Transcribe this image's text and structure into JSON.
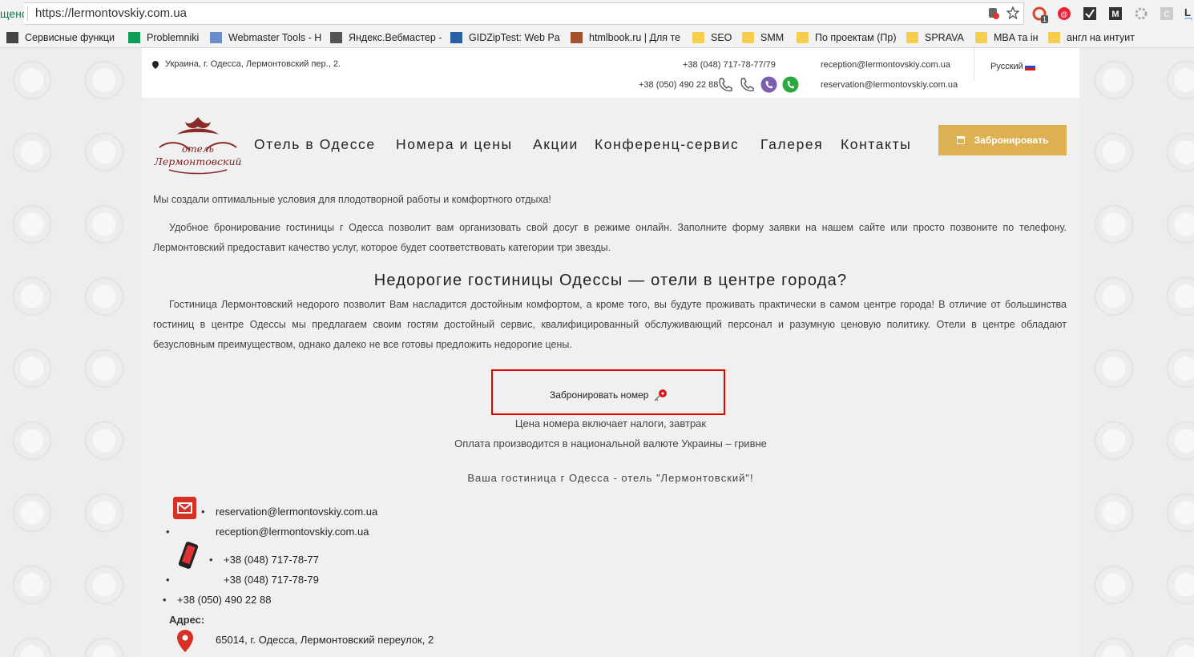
{
  "browser": {
    "secure_prefix": "щено",
    "url": "https://lermontovskiy.com.ua",
    "bookmarks": [
      {
        "label": "Сервисные функци",
        "icon": "printer-icon"
      },
      {
        "label": "Problemniki",
        "icon": "sheets-icon"
      },
      {
        "label": "Webmaster Tools - Н",
        "icon": "webmaster-icon"
      },
      {
        "label": "Яндекс.Вебмастер -",
        "icon": "code-icon"
      },
      {
        "label": "GIDZipTest: Web Pa",
        "icon": "gid-icon"
      },
      {
        "label": "htmlbook.ru | Для те",
        "icon": "htmlbook-icon"
      },
      {
        "label": "SEO",
        "icon": "folder-icon"
      },
      {
        "label": "SMM",
        "icon": "folder-icon"
      },
      {
        "label": "По проектам (Пр)",
        "icon": "folder-icon"
      },
      {
        "label": "SPRAVA",
        "icon": "folder-icon"
      },
      {
        "label": "MBA та ін",
        "icon": "folder-icon"
      },
      {
        "label": "англ на интуит",
        "icon": "folder-icon"
      }
    ],
    "ext_badge": "1"
  },
  "topbar": {
    "address": "Украина, г. Одесса, Лермонтовский пер., 2.",
    "phone1": "+38 (048) 717-78-77/79",
    "phone2": "+38 (050) 490 22 88",
    "email1": "reception@lermontovskiy.com.ua",
    "email2": "reservation@lermontovskiy.com.ua",
    "language": "Русский"
  },
  "logo": {
    "line1": "отель",
    "line2": "Лермонтовский"
  },
  "nav": [
    "Отель в Одессе",
    "Номера и цены",
    "Акции",
    "Конференц-сервис",
    "Галерея",
    "Контакты"
  ],
  "book_button": "Забронировать",
  "body": {
    "intro": "Мы создали оптимальные условия для плодотворной работы и комфортного отдыха!",
    "para1": "Удобное бронирование гостиницы г Одесса позволит вам организовать свой досуг в режиме онлайн. Заполните форму заявки на нашем сайте или просто позвоните по телефону. Лермонтовский предоставит качество услуг, которое будет соответствовать категории три звезды.",
    "heading": "Недорогие гостиницы Одессы —  отели в центре города?",
    "para2": "Гостиница Лермонтовский недорого позволит Вам насладится достойным комфортом, а кроме того, вы будуте проживать практически в самом центре города! В отличие от большинства гостиниц в центре Одессы мы предлагаем своим гостям достойный сервис, квалифицированный обслуживающий персонал и разумную ценовую политику. Отели в центре обладают безусловным преимуществом, однако далеко не все готовы предложить недорогие цены.",
    "book_room": "Забронировать номер",
    "price_note": "Цена номера включает налоги, завтрак",
    "payment_note": "Оплата производится в национальной валюте Украины – гривне",
    "tagline": "Ваша гостиница г Одесса -  отель \"Лермонтовский\"!"
  },
  "contacts": {
    "email1": "reservation@lermontovskiy.com.ua",
    "email2": "reception@lermontovskiy.com.ua",
    "phone1": "+38 (048) 717-78-77",
    "phone2": "+38 (048) 717-78-79",
    "phone3": "+38 (050) 490 22 88",
    "address_label": "Адрес:",
    "address": "65014, г. Одесса, Лермонтовский переулок, 2"
  },
  "colors": {
    "accent": "#ddb052",
    "highlight_border": "#e00000",
    "viber": "#7d5fb0",
    "whatsapp": "#2aa93c"
  }
}
